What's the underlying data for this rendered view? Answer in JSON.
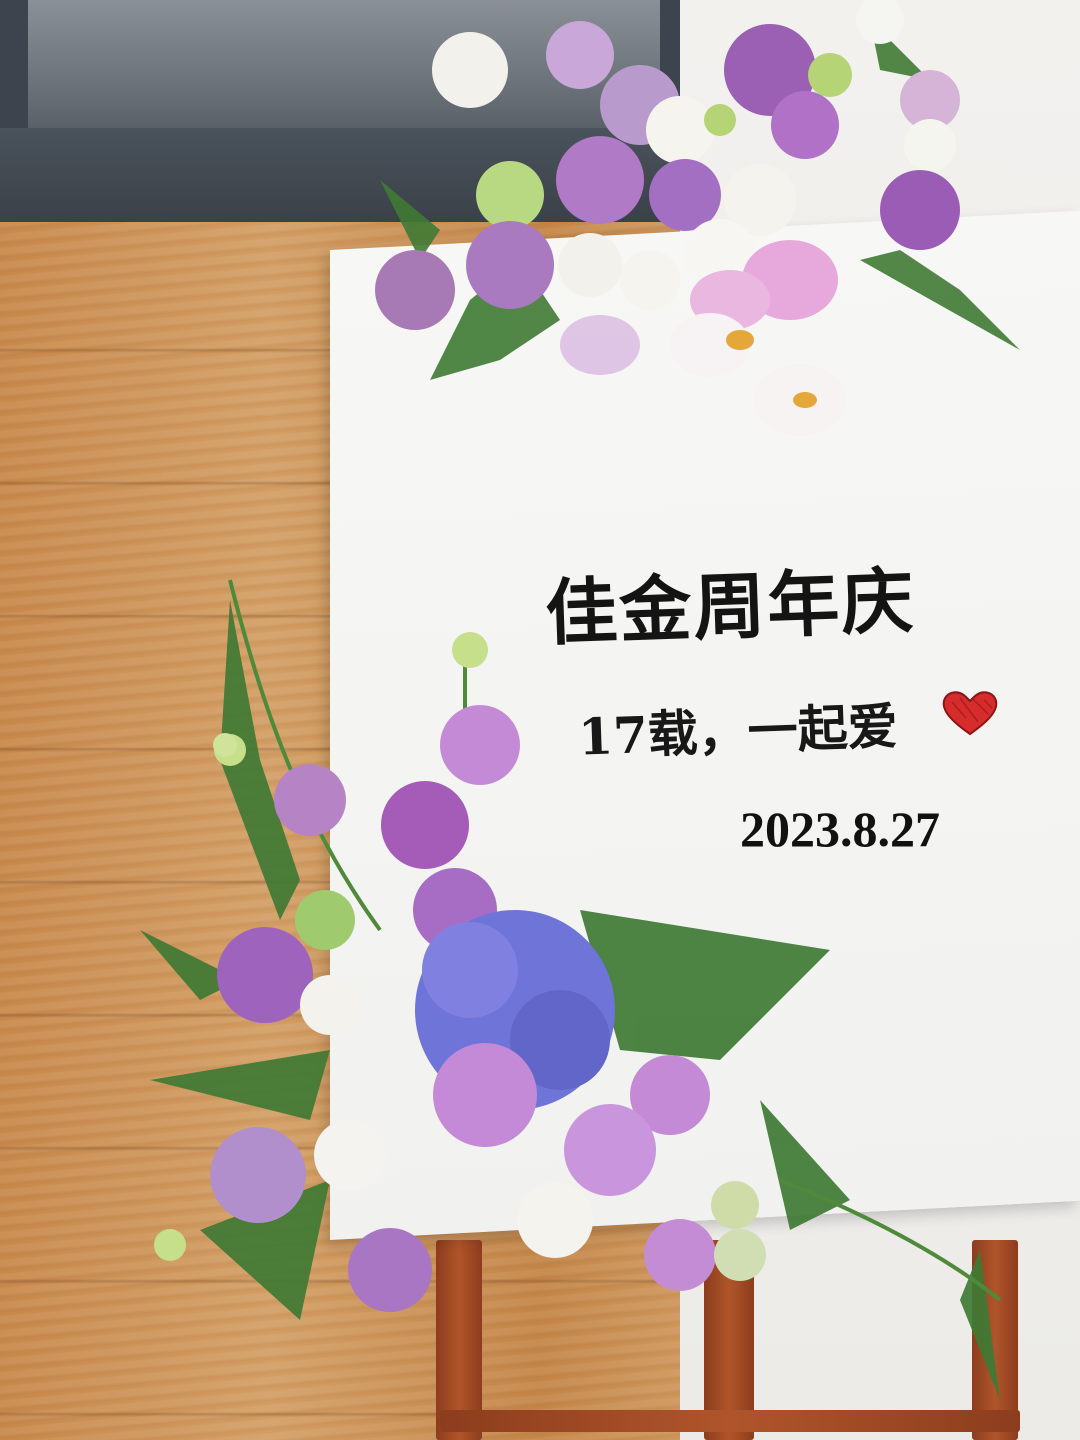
{
  "sign": {
    "title": "佳金周年庆",
    "subtitle": "17载，一起爱",
    "date": "2023.8.27"
  },
  "colors": {
    "board": "#f5f5f3",
    "wood": "#c98e4f",
    "easel": "#a14a24",
    "heart": "#d62c2c",
    "lisianthus_purple": "#b07ac6",
    "hydrangea_blue": "#6f74d8",
    "fern_green": "#3f7a34",
    "white_flower": "#f4f2ee",
    "orchid_pink": "#e7a9dc"
  },
  "icons": {
    "heart": "heart-icon"
  }
}
